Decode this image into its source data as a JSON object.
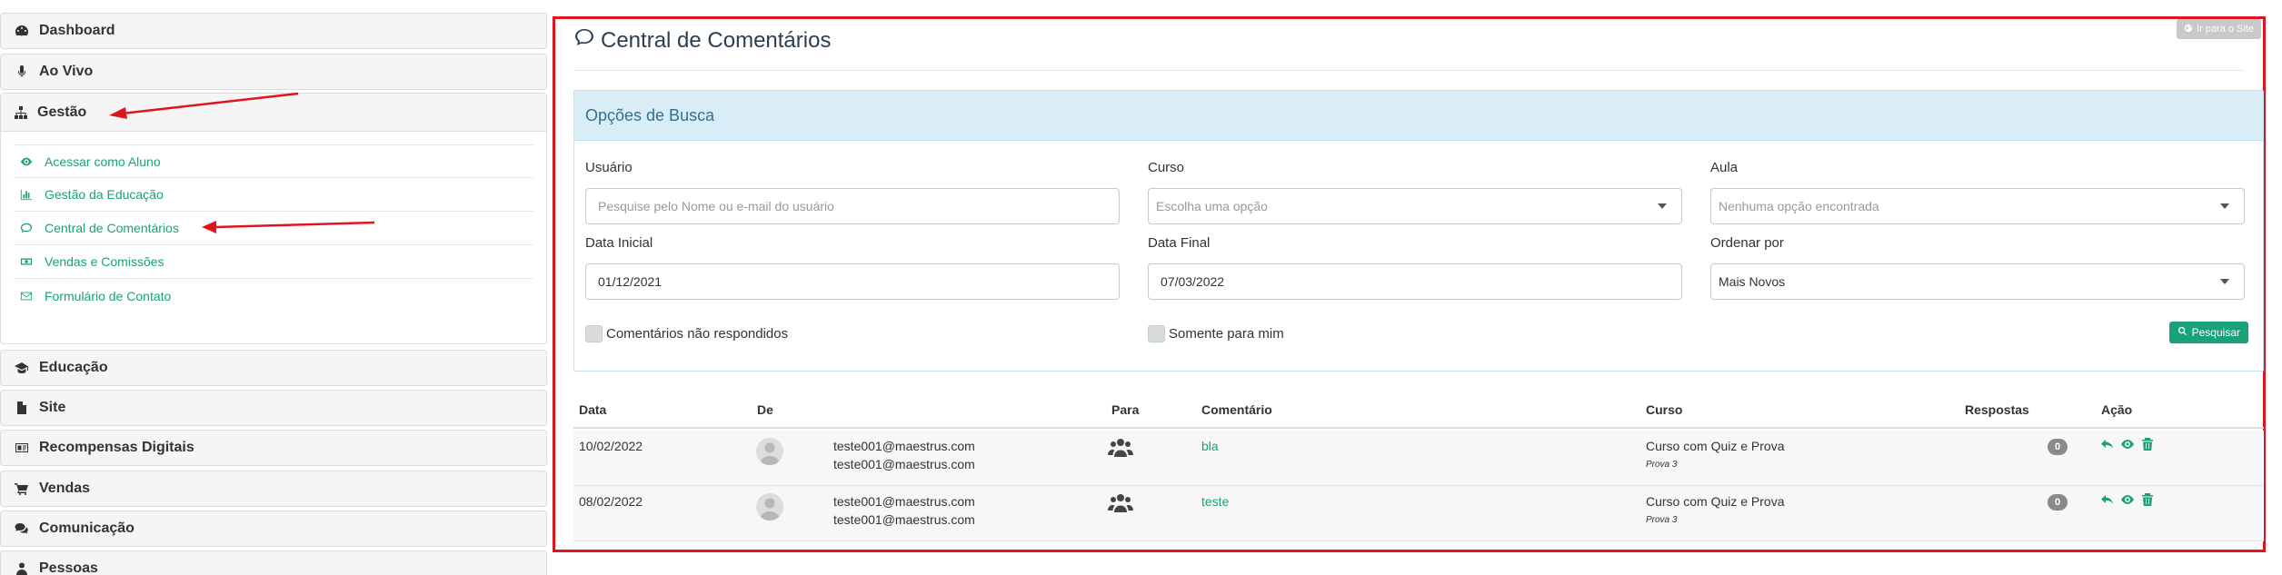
{
  "sidebar": {
    "items_top": [
      {
        "label": "Dashboard",
        "icon": "dashboard-icon"
      },
      {
        "label": "Ao Vivo",
        "icon": "microphone-icon"
      }
    ],
    "group": {
      "label": "Gestão",
      "icon": "sitemap-icon",
      "items": [
        {
          "label": "Acessar como Aluno",
          "icon": "eye-icon"
        },
        {
          "label": "Gestão da Educação",
          "icon": "bar-chart-icon"
        },
        {
          "label": "Central de Comentários",
          "icon": "comment-icon"
        },
        {
          "label": "Vendas e Comissões",
          "icon": "money-icon"
        },
        {
          "label": "Formulário de Contato",
          "icon": "envelope-icon"
        }
      ]
    },
    "items_bottom": [
      {
        "label": "Educação",
        "icon": "graduation-cap-icon"
      },
      {
        "label": "Site",
        "icon": "file-icon"
      },
      {
        "label": "Recompensas Digitais",
        "icon": "id-card-icon"
      },
      {
        "label": "Vendas",
        "icon": "cart-icon"
      },
      {
        "label": "Comunicação",
        "icon": "comments-icon"
      },
      {
        "label": "Pessoas",
        "icon": "user-icon"
      }
    ]
  },
  "main": {
    "title": "Central de Comentários",
    "site_button": "Ir para o Site",
    "search": {
      "heading": "Opções de Busca",
      "usuario_label": "Usuário",
      "usuario_placeholder": "Pesquise pelo Nome ou e-mail do usuário",
      "curso_label": "Curso",
      "curso_value": "Escolha uma opção",
      "aula_label": "Aula",
      "aula_value": "Nenhuma opção encontrada",
      "data_inicial_label": "Data Inicial",
      "data_inicial_value": "01/12/2021",
      "data_final_label": "Data Final",
      "data_final_value": "07/03/2022",
      "ordenar_label": "Ordenar por",
      "ordenar_value": "Mais Novos",
      "chk_nao_respondidos": "Comentários não respondidos",
      "chk_somente_mim": "Somente para mim",
      "search_button": "Pesquisar"
    },
    "table": {
      "headers": {
        "data": "Data",
        "de": "De",
        "para": "Para",
        "comentario": "Comentário",
        "curso": "Curso",
        "respostas": "Respostas",
        "acao": "Ação"
      },
      "rows": [
        {
          "data": "10/02/2022",
          "de_line1": "teste001@maestrus.com",
          "de_line2": "teste001@maestrus.com",
          "comentario": "bla",
          "curso": "Curso com Quiz e Prova",
          "aula": "Prova 3",
          "respostas": "0"
        },
        {
          "data": "08/02/2022",
          "de_line1": "teste001@maestrus.com",
          "de_line2": "teste001@maestrus.com",
          "comentario": "teste",
          "curso": "Curso com Quiz e Prova",
          "aula": "Prova 3",
          "respostas": "0"
        }
      ]
    }
  },
  "colors": {
    "accent": "#1aa179",
    "highlight_border": "#e0141e",
    "panel_heading_bg": "#d9edf7"
  }
}
